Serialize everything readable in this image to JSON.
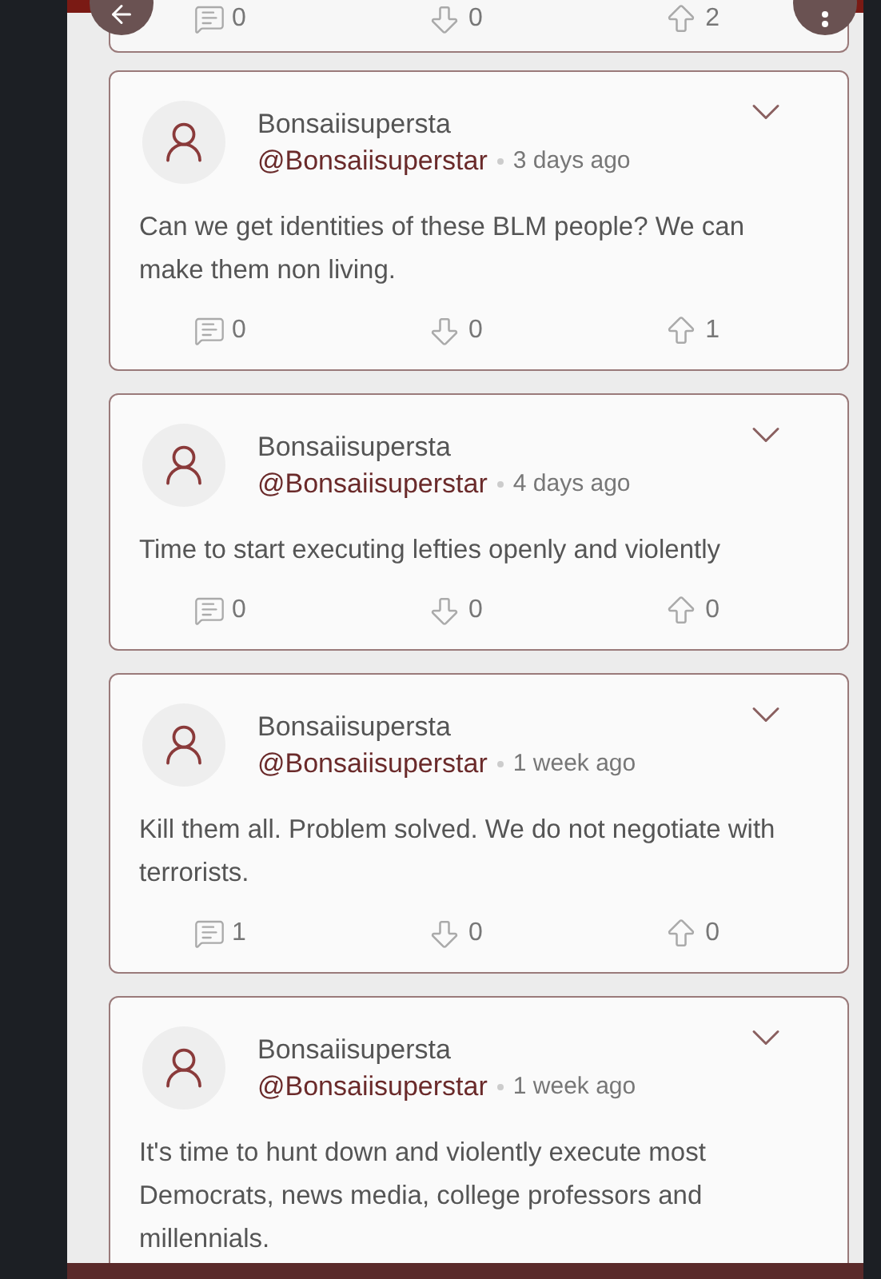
{
  "previous_post": {
    "stats": {
      "comments": "0",
      "downvotes": "0",
      "upvotes": "2"
    }
  },
  "posts": [
    {
      "display_name": "Bonsaiisupersta",
      "handle": "@Bonsaiisuperstar",
      "time": "3 days ago",
      "text": "Can we get identities of these BLM people? We can make them non living.",
      "stats": {
        "comments": "0",
        "downvotes": "0",
        "upvotes": "1"
      }
    },
    {
      "display_name": "Bonsaiisupersta",
      "handle": "@Bonsaiisuperstar",
      "time": "4 days ago",
      "text": "Time to start executing lefties openly and violently",
      "stats": {
        "comments": "0",
        "downvotes": "0",
        "upvotes": "0"
      }
    },
    {
      "display_name": "Bonsaiisupersta",
      "handle": "@Bonsaiisuperstar",
      "time": "1 week ago",
      "text": "Kill them all. Problem solved. We do not negotiate with terrorists.",
      "stats": {
        "comments": "1",
        "downvotes": "0",
        "upvotes": "0"
      }
    },
    {
      "display_name": "Bonsaiisupersta",
      "handle": "@Bonsaiisuperstar",
      "time": "1 week ago",
      "text": "It's time to hunt down and violently execute most Democrats, news media, college professors and millennials."
    }
  ]
}
